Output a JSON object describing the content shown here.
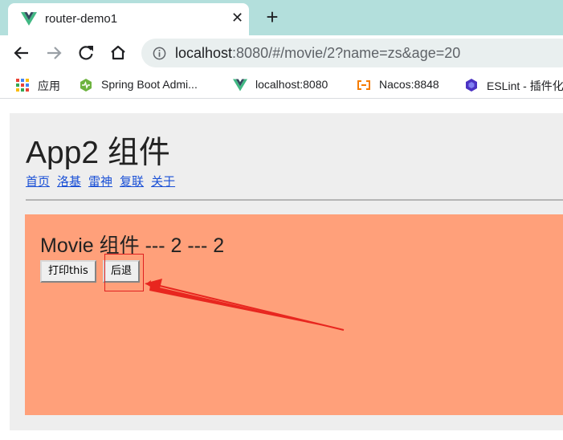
{
  "browser": {
    "tab": {
      "title": "router-demo1",
      "close": "✕",
      "favicon": "vue-logo-icon"
    },
    "new_tab": "+",
    "address": {
      "host": "localhost",
      "path": ":8080/#/movie/2?name=zs&age=20"
    },
    "bookmarks": [
      {
        "label": "应用",
        "icon": "apps-grid-icon"
      },
      {
        "label": "Spring Boot Admi...",
        "icon": "spring-boot-admin-icon"
      },
      {
        "label": "localhost:8080",
        "icon": "vue-logo-icon"
      },
      {
        "label": "Nacos:8848",
        "icon": "nacos-icon"
      },
      {
        "label": "ESLint - 插件化",
        "icon": "eslint-icon"
      }
    ]
  },
  "app": {
    "title": "App2 组件",
    "nav": [
      "首页",
      "洛基",
      "雷神",
      "复联",
      "关于"
    ],
    "movie": {
      "title": "Movie 组件 --- 2 --- 2",
      "print_button": "打印this",
      "back_button": "后退"
    }
  },
  "colors": {
    "tab_strip": "#b3dfdc",
    "panel": "#ffa07a",
    "app_bg": "#eeeeee",
    "link": "#1a50d6",
    "annotation": "#e02020"
  }
}
